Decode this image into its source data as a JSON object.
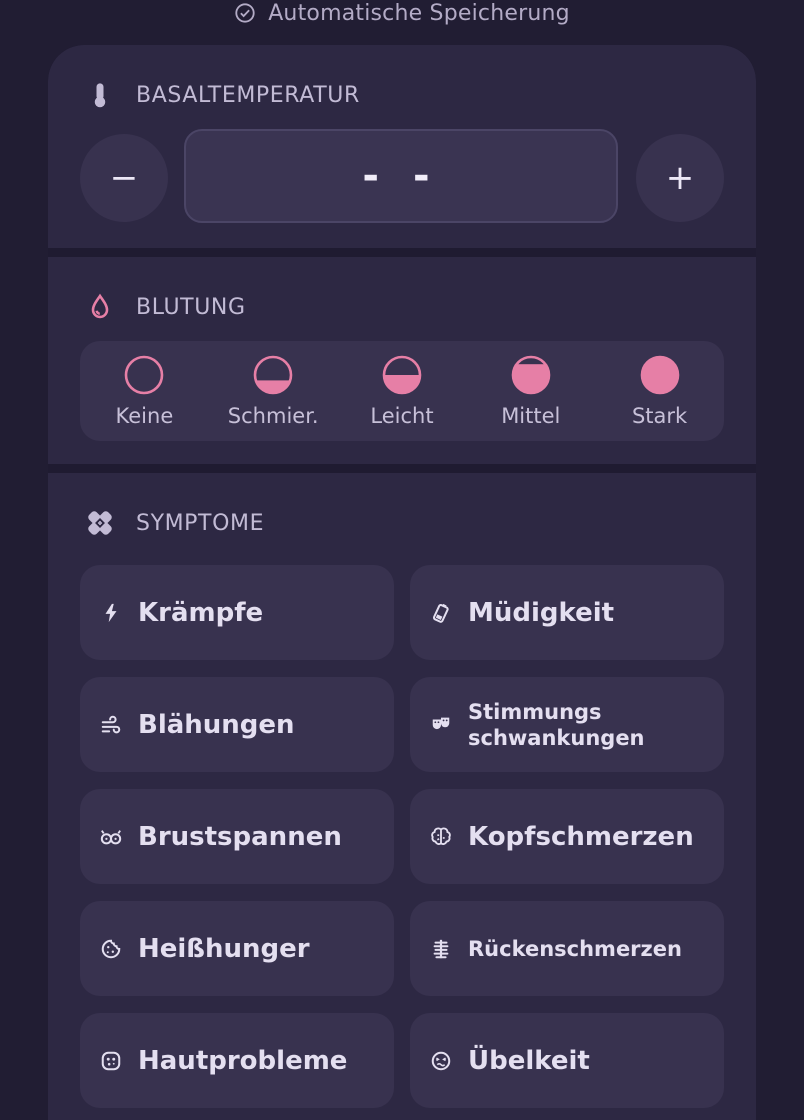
{
  "autosave": {
    "label": "Automatische Speicherung",
    "icon": "check-circle-icon"
  },
  "temperature": {
    "title": "BASALTEMPERATUR",
    "icon": "thermometer-icon",
    "decrement_label": "−",
    "increment_label": "+",
    "value": "- -"
  },
  "bleeding": {
    "title": "BLUTUNG",
    "icon": "drop-icon",
    "accent": "#e67fa6",
    "options": [
      {
        "label": "Keine",
        "fill": 0
      },
      {
        "label": "Schmier.",
        "fill": 0.35
      },
      {
        "label": "Leicht",
        "fill": 0.5
      },
      {
        "label": "Mittel",
        "fill": 0.8
      },
      {
        "label": "Stark",
        "fill": 1
      }
    ]
  },
  "symptoms": {
    "title": "SYMPTOME",
    "icon": "bandage-icon",
    "items": [
      {
        "label": "Krämpfe",
        "icon": "bolt-icon"
      },
      {
        "label": "Müdigkeit",
        "icon": "battery-low-icon"
      },
      {
        "label": "Blähungen",
        "icon": "wind-icon"
      },
      {
        "label": "Stimmungs schwankungen",
        "icon": "masks-icon"
      },
      {
        "label": "Brustspannen",
        "icon": "breast-icon"
      },
      {
        "label": "Kopfschmerzen",
        "icon": "brain-icon"
      },
      {
        "label": "Heißhunger",
        "icon": "cookie-icon"
      },
      {
        "label": "Rückenschmerzen",
        "icon": "spine-icon"
      },
      {
        "label": "Hautprobleme",
        "icon": "face-skin-icon"
      },
      {
        "label": "Übelkeit",
        "icon": "nausea-face-icon"
      }
    ]
  }
}
